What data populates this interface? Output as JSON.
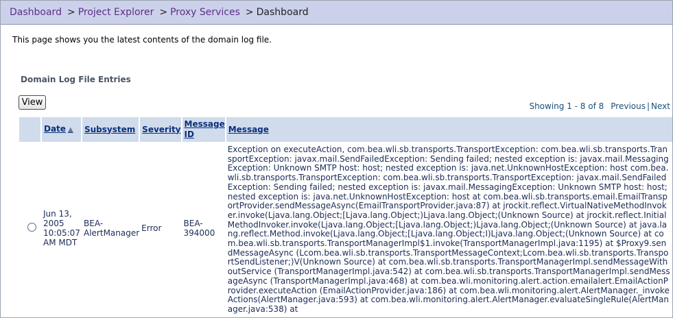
{
  "breadcrumb": {
    "items": [
      "Dashboard",
      "Project Explorer",
      "Proxy Services"
    ],
    "separator": ">",
    "current": "Dashboard"
  },
  "intro_text": "This page shows you the latest contents of the domain log file.",
  "section_title": "Domain Log File Entries",
  "view_button": "View",
  "pager": {
    "showing": "Showing 1 - 8 of 8",
    "previous": "Previous",
    "divider": "|",
    "next": "Next"
  },
  "table": {
    "columns": [
      "Date",
      "Subsystem",
      "Severity",
      "Message ID",
      "Message"
    ],
    "sort_icon": "sort-ascending-icon",
    "rows": [
      {
        "date": "Jun 13, 2005 10:05:07 AM MDT",
        "subsystem": "BEA-AlertManager",
        "severity": "Error",
        "message_id": "BEA-394000",
        "message": "Exception on executeAction, com.bea.wli.sb.transports.TransportException: com.bea.wli.sb.transports.TransportException: javax.mail.SendFailedException: Sending failed; nested exception is: javax.mail.MessagingException: Unknown SMTP host: host; nested exception is: java.net.UnknownHostException: host com.bea.wli.sb.transports.TransportException: com.bea.wli.sb.transports.TransportException: javax.mail.SendFailedException: Sending failed; nested exception is: javax.mail.MessagingException: Unknown SMTP host: host; nested exception is: java.net.UnknownHostException: host at com.bea.wli.sb.transports.email.EmailTransportProvider.sendMessageAsync(EmailTransportProvider.java:87) at jrockit.reflect.VirtualNativeMethodInvoker.invoke(Ljava.lang.Object;[Ljava.lang.Object;)Ljava.lang.Object;(Unknown Source) at jrockit.reflect.InitialMethodInvoker.invoke(Ljava.lang.Object;[Ljava.lang.Object;)Ljava.lang.Object;(Unknown Source) at java.lang.reflect.Method.invoke(Ljava.lang.Object;[Ljava.lang.Object;I)Ljava.lang.Object;(Unknown Source) at com.bea.wli.sb.transports.TransportManagerImpl$1.invoke(TransportManagerImpl.java:1195) at $Proxy9.sendMessageAsync (Lcom.bea.wli.sb.transports.TransportMessageContext;Lcom.bea.wli.sb.transports.TransportSendListener;)V(Unknown Source) at com.bea.wli.sb.transports.TransportManagerImpl.sendMessageWithoutService (TransportManagerImpl.java:542) at com.bea.wli.sb.transports.TransportManagerImpl.sendMessageAsync (TransportManagerImpl.java:468) at com.bea.wli.monitoring.alert.action.emailalert.EmailActionProvider.executeAction (EmailActionProvider.java:186) at com.bea.wli.monitoring.alert.AlertManager._invokeActions(AlertManager.java:593) at com.bea.wli.monitoring.alert.AlertManager.evaluateSingleRule(AlertManager.java:538) at"
      }
    ]
  }
}
